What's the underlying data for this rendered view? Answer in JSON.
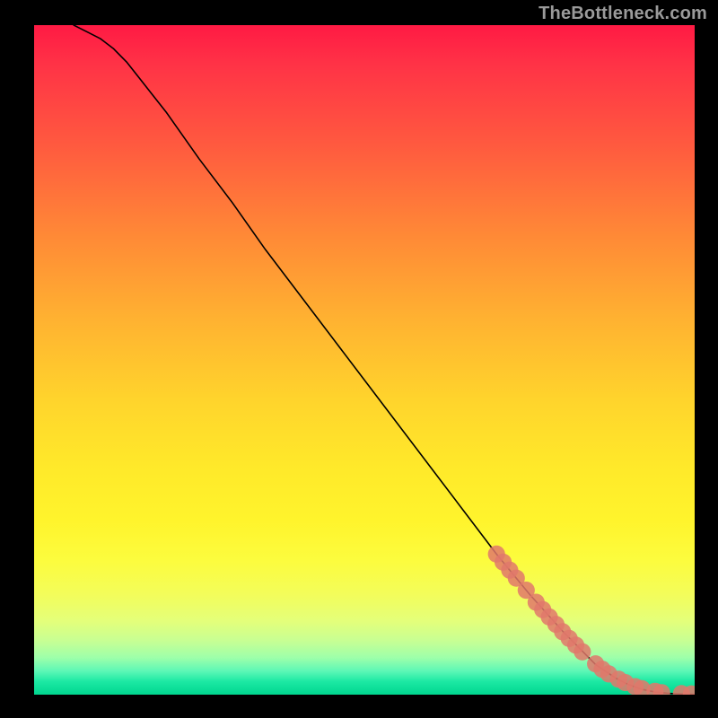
{
  "attribution": "TheBottleneck.com",
  "chart_data": {
    "type": "line",
    "title": "",
    "xlabel": "",
    "ylabel": "",
    "xlim": [
      0,
      100
    ],
    "ylim": [
      0,
      100
    ],
    "grid": false,
    "legend": false,
    "curve": {
      "name": "bottleneck-curve",
      "color": "#000000",
      "x": [
        6,
        8,
        10,
        12,
        14,
        16,
        18,
        20,
        25,
        30,
        35,
        40,
        45,
        50,
        55,
        60,
        65,
        70,
        75,
        80,
        85,
        88,
        90,
        92,
        94,
        96,
        98,
        100
      ],
      "y": [
        100,
        99,
        98,
        96.5,
        94.5,
        92,
        89.5,
        87,
        80,
        73.5,
        66.5,
        60,
        53.5,
        47,
        40.5,
        34,
        27.5,
        21,
        15,
        9.5,
        4.5,
        2.5,
        1.5,
        0.8,
        0.4,
        0.2,
        0.1,
        0.05
      ]
    },
    "markers": {
      "name": "data-points",
      "color": "#e0786b",
      "radius": 1.3,
      "x": [
        70,
        71,
        72,
        73,
        74.5,
        76,
        77,
        78,
        79,
        80,
        81,
        82,
        83,
        85,
        86,
        87,
        88.5,
        89.5,
        91,
        92,
        94,
        95,
        98,
        99.5
      ],
      "y": [
        21,
        19.8,
        18.6,
        17.4,
        15.6,
        13.8,
        12.7,
        11.6,
        10.5,
        9.4,
        8.4,
        7.4,
        6.4,
        4.6,
        3.8,
        3.1,
        2.3,
        1.8,
        1.2,
        0.9,
        0.5,
        0.3,
        0.15,
        0.1
      ]
    }
  }
}
